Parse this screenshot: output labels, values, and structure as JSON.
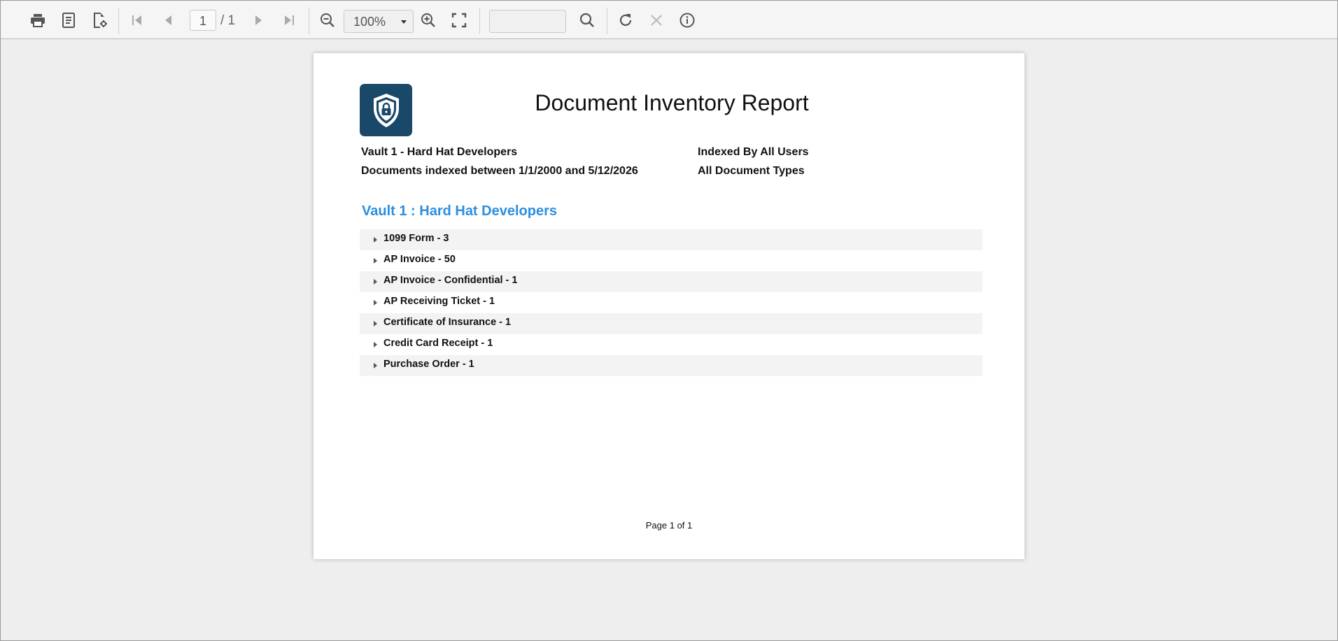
{
  "toolbar": {
    "icons": {
      "print": "print-icon",
      "export": "document-icon",
      "settings": "document-settings-icon",
      "first": "first-page-icon",
      "prev": "previous-page-icon",
      "next": "next-page-icon",
      "last": "last-page-icon",
      "zoom_out": "zoom-out-icon",
      "zoom_in": "zoom-in-icon",
      "fit": "fit-page-icon",
      "search": "search-icon",
      "refresh": "refresh-icon",
      "cancel": "cancel-icon",
      "info": "info-icon"
    },
    "page_number": "1",
    "page_total": "/ 1",
    "zoom_value": "100%",
    "search_value": ""
  },
  "report": {
    "logo_icon": "shield-lock-icon",
    "title": "Document Inventory Report",
    "vault_line": "Vault 1 - Hard Hat Developers",
    "date_range": "Documents indexed between 1/1/2000 and 5/12/2026",
    "indexed_by": "Indexed By All Users",
    "doc_types": "All Document Types",
    "vault_heading": "Vault 1 : Hard Hat Developers",
    "items": [
      {
        "label": "1099 Form - 3"
      },
      {
        "label": "AP Invoice - 50"
      },
      {
        "label": "AP Invoice - Confidential - 1"
      },
      {
        "label": "AP Receiving Ticket - 1"
      },
      {
        "label": "Certificate of Insurance - 1"
      },
      {
        "label": "Credit Card Receipt - 1"
      },
      {
        "label": "Purchase Order - 1"
      }
    ],
    "footer": "Page 1 of 1"
  },
  "colors": {
    "accent": "#2c8ee0",
    "logo_bg": "#1a4869",
    "row_alt": "#f3f3f3"
  }
}
